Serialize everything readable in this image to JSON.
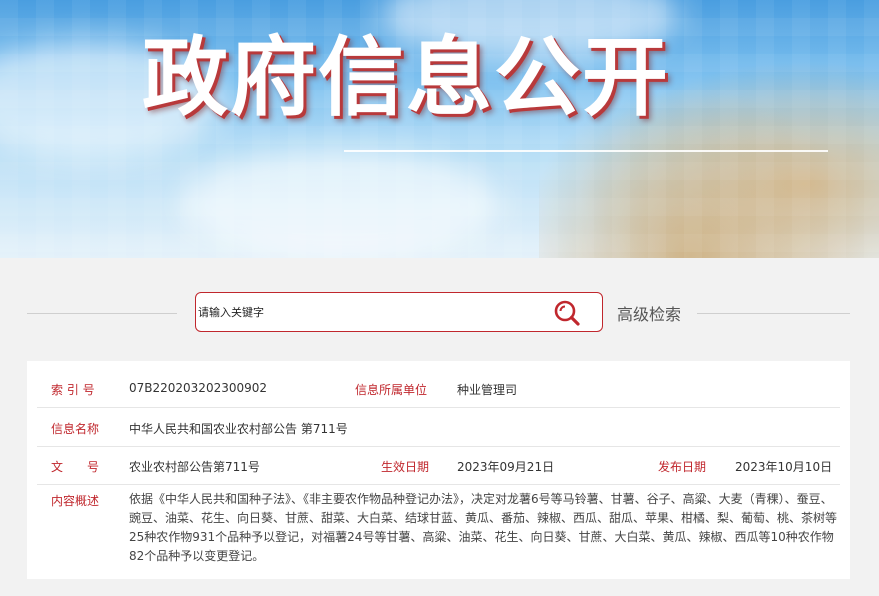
{
  "banner": {
    "title": "政府信息公开"
  },
  "search": {
    "placeholder": "请输入关键字",
    "advanced_label": "高级检索"
  },
  "info": {
    "index_label": "索 引 号",
    "index_value": "07B220203202300902",
    "dept_label": "信息所属单位",
    "dept_value": "种业管理司",
    "name_label": "信息名称",
    "name_value": "中华人民共和国农业农村部公告 第711号",
    "docno_label": "文　　号",
    "docno_value": "农业农村部公告第711号",
    "effective_label": "生效日期",
    "effective_value": "2023年09月21日",
    "publish_label": "发布日期",
    "publish_value": "2023年10月10日",
    "summary_label": "内容概述",
    "summary_value": "依据《中华人民共和国种子法》、《非主要农作物品种登记办法》，决定对龙薯6号等马铃薯、甘薯、谷子、高粱、大麦（青稞）、蚕豆、豌豆、油菜、花生、向日葵、甘蔗、甜菜、大白菜、结球甘蓝、黄瓜、番茄、辣椒、西瓜、甜瓜、苹果、柑橘、梨、葡萄、桃、茶树等25种农作物931个品种予以登记，对福薯24号等甘薯、高粱、油菜、花生、向日葵、甘蔗、大白菜、黄瓜、辣椒、西瓜等10种农作物82个品种予以变更登记。"
  },
  "colors": {
    "accent": "#c0272d",
    "label_red": "#c0272d"
  },
  "icons": {
    "search": "search-icon"
  }
}
